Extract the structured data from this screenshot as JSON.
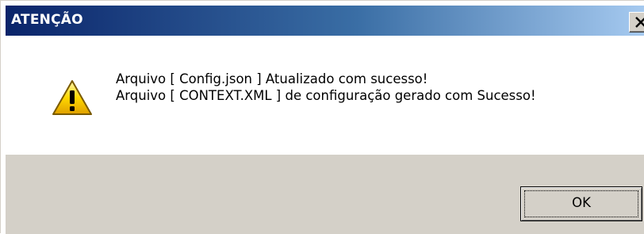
{
  "window": {
    "title": "ATENÇÃO"
  },
  "message": {
    "line1": "Arquivo [ Config.json ] Atualizado com sucesso!",
    "line2": "Arquivo [ CONTEXT.XML ] de configuração gerado com Sucesso!"
  },
  "buttons": {
    "ok_label": "OK"
  },
  "icons": {
    "status": "warning-icon",
    "close": "close-icon"
  },
  "colors": {
    "title_gradient_start": "#0a246a",
    "title_gradient_end": "#a6caf0",
    "dialog_face": "#d4d0c8",
    "warning_yellow": "#ffd800"
  }
}
